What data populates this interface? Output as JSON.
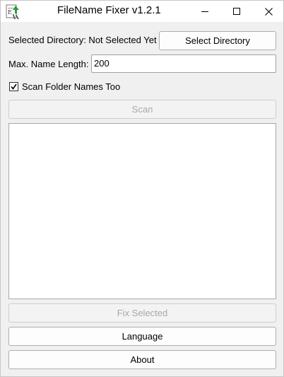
{
  "window": {
    "title": "FileName Fixer v1.2.1",
    "icons": {
      "app": "app-icon",
      "minimize": "minimize-icon",
      "maximize": "maximize-icon",
      "close": "close-icon"
    }
  },
  "directory": {
    "label": "Selected Directory: Not Selected Yet",
    "button": "Select Directory"
  },
  "max_length": {
    "label": "Max. Name Length:",
    "value": "200"
  },
  "scan_folders": {
    "label": "Scan Folder Names Too",
    "checked": true
  },
  "buttons": {
    "scan": "Scan",
    "fix_selected": "Fix Selected",
    "language": "Language",
    "about": "About"
  },
  "results_list": {
    "items": []
  },
  "colors": {
    "background": "#f0f0f0",
    "titlebar": "#ffffff",
    "disabled_text": "#a8a8a8"
  }
}
